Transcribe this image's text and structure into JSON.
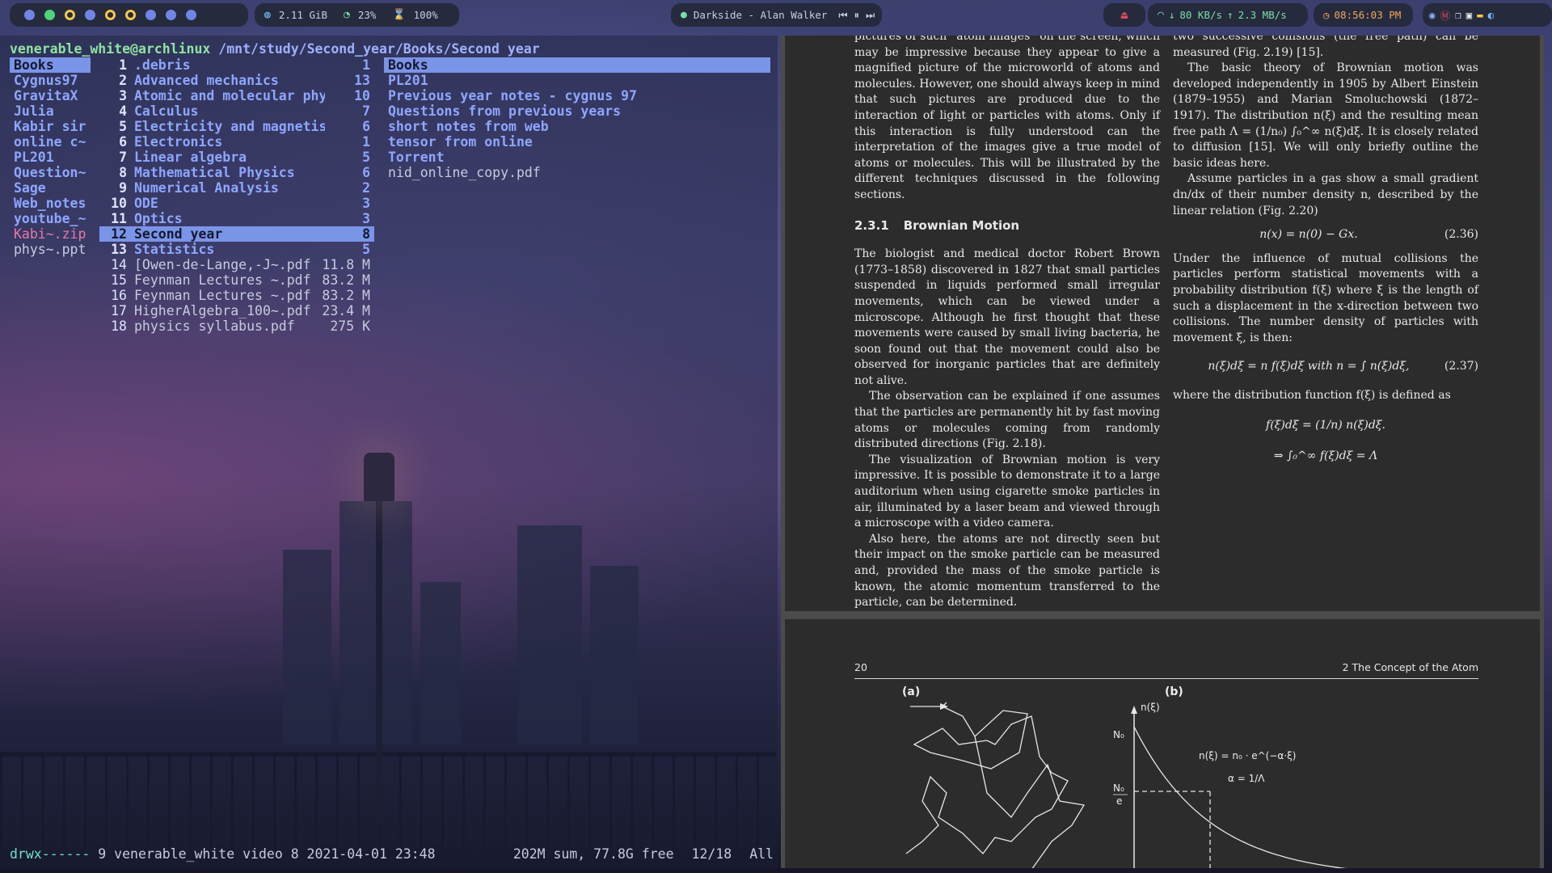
{
  "topbar": {
    "workspaces": [
      "filled",
      "active",
      "ring",
      "filled",
      "ring",
      "ring",
      "filled",
      "filled",
      "filled"
    ],
    "memory": "2.11 GiB",
    "cpu": "23%",
    "battery": "100%",
    "music": {
      "track": "Darkside - Alan Walker"
    },
    "network": {
      "down": "80 KB/s",
      "up": "2.3 MB/s"
    },
    "clock": "08:56:03 PM",
    "colors": {
      "pill_bg": "#262a3d",
      "accent": "#6f86e6",
      "active_ws": "#4fd37b",
      "ring_ws": "#f2c94c"
    }
  },
  "terminal": {
    "user_host": "venerable_white@archlinux",
    "path": " /mnt/study/Second_year/Books/Second year",
    "parent_column": [
      {
        "name": "Books",
        "type": "dir",
        "selected": true
      },
      {
        "name": "Cygnus97",
        "type": "dir"
      },
      {
        "name": "GravitaX",
        "type": "dir"
      },
      {
        "name": "Julia",
        "type": "dir"
      },
      {
        "name": "Kabir sir",
        "type": "dir"
      },
      {
        "name": "online c~",
        "type": "dir"
      },
      {
        "name": "PL201",
        "type": "dir"
      },
      {
        "name": "Question~",
        "type": "dir"
      },
      {
        "name": "Sage",
        "type": "dir"
      },
      {
        "name": "Web_notes",
        "type": "dir"
      },
      {
        "name": "youtube_~",
        "type": "dir"
      },
      {
        "name": "Kabi~.zip",
        "type": "arch"
      },
      {
        "name": "phys~.ppt",
        "type": "file"
      }
    ],
    "current_column": [
      {
        "num": "1",
        "name": ".debris",
        "size": "1",
        "type": "dir"
      },
      {
        "num": "2",
        "name": "Advanced mechanics",
        "size": "13",
        "type": "dir"
      },
      {
        "num": "3",
        "name": "Atomic and molecular phys~",
        "size": "10",
        "type": "dir"
      },
      {
        "num": "4",
        "name": "Calculus",
        "size": "7",
        "type": "dir"
      },
      {
        "num": "5",
        "name": "Electricity and magnetism",
        "size": "6",
        "type": "dir"
      },
      {
        "num": "6",
        "name": "Electronics",
        "size": "1",
        "type": "dir"
      },
      {
        "num": "7",
        "name": "Linear algebra",
        "size": "5",
        "type": "dir"
      },
      {
        "num": "8",
        "name": "Mathematical Physics",
        "size": "6",
        "type": "dir"
      },
      {
        "num": "9",
        "name": "Numerical Analysis",
        "size": "2",
        "type": "dir"
      },
      {
        "num": "10",
        "name": "ODE",
        "size": "3",
        "type": "dir"
      },
      {
        "num": "11",
        "name": "Optics",
        "size": "3",
        "type": "dir"
      },
      {
        "num": "12",
        "name": "Second year",
        "size": "8",
        "type": "dir",
        "selected": true
      },
      {
        "num": "13",
        "name": "Statistics",
        "size": "5",
        "type": "dir"
      },
      {
        "num": "14",
        "name": "[Owen-de-Lange,-J~.pdf",
        "size": "11.8 M",
        "type": "file"
      },
      {
        "num": "15",
        "name": "Feynman Lectures ~.pdf",
        "size": "83.2 M",
        "type": "file"
      },
      {
        "num": "16",
        "name": "Feynman Lectures ~.pdf",
        "size": "83.2 M",
        "type": "file"
      },
      {
        "num": "17",
        "name": "HigherAlgebra_100~.pdf",
        "size": "23.4 M",
        "type": "file"
      },
      {
        "num": "18",
        "name": "physics syllabus.pdf",
        "size": "275 K",
        "type": "file"
      }
    ],
    "preview_column": [
      {
        "name": "Books",
        "type": "dir",
        "selected": true
      },
      {
        "name": "PL201",
        "type": "dir"
      },
      {
        "name": "Previous year notes - cygnus 97",
        "type": "dir"
      },
      {
        "name": "Questions from previous years",
        "type": "dir"
      },
      {
        "name": "short notes from web",
        "type": "dir"
      },
      {
        "name": "tensor from online",
        "type": "dir"
      },
      {
        "name": "Torrent",
        "type": "dir"
      },
      {
        "name": "nid_online_copy.pdf",
        "type": "file"
      }
    ],
    "status": {
      "perms": "drwx------",
      "info": " 9 venerable_white video 8 2021-04-01 23:48",
      "summary": "202M sum, 77.8G free",
      "position": "12/18",
      "scroll": "All"
    }
  },
  "pdf": {
    "left_col": {
      "p1": "pictures of such “atom images” on the screen, which may be impressive because they appear to give a magnified picture of the microworld of atoms and molecules. However, one should always keep in mind that such pictures are produced due to the interaction of light or particles with atoms. Only if this interaction is fully understood can the interpretation of the images give a true model of atoms or molecules. This will be illustrated by the different techniques discussed in the following sections.",
      "section_num": "2.3.1",
      "section_title": "Brownian Motion",
      "p2": "The biologist and medical doctor Robert Brown (1773–1858) discovered in 1827 that small particles suspended in liquids performed small irregular movements, which can be viewed under a microscope. Although he first thought that these movements were caused by small living bacteria, he soon found out that the movement could also be observed for inorganic particles that are definitely not alive.",
      "p3": "The observation can be explained if one assumes that the particles are permanently hit by fast moving atoms or molecules coming from randomly distributed directions (Fig. 2.18).",
      "p4": "The visualization of Brownian motion is very impressive. It is possible to demonstrate it to a large auditorium when using cigarette smoke particles in air, illuminated by a laser beam and viewed through a microscope with a video camera.",
      "p5": "Also here, the atoms are not directly seen but their impact on the smoke particle can be measured and, provided the mass of the smoke particle is known, the atomic momentum transferred to the particle, can be determined."
    },
    "right_col": {
      "p0": "two successive collisions (the free path) can be measured (Fig. 2.19) [15].",
      "p1a": "The basic theory of Brownian motion was developed independently in 1905 by Albert Einstein (1879–1955) and Marian Smoluchowski (1872–1917). The distribution n(ξ) and the resulting mean free path Λ = (1/n₀) ∫₀^∞ n(ξ)dξ. It is closely related to diffusion [15]. We will only briefly outline the basic ideas here.",
      "p2": "Assume particles in a gas show a small gradient dn/dx of their number density n, described by the linear relation (Fig. 2.20)",
      "eq36": "n(x) = n(0) − Gx.",
      "eq36_num": "(2.36)",
      "p3": "Under the influence of mutual collisions the particles perform statistical movements with a probability distribution f(ξ) where ξ is the length of such a displacement in the x-direction between two collisions. The number density of particles with movement ξ, is then:",
      "eq37": "n(ξ)dξ = n f(ξ)dξ   with   n = ∫ n(ξ)dξ,",
      "eq37_num": "(2.37)",
      "p4": "where the distribution function f(ξ) is defined as",
      "eq38": "f(ξ)dξ = (1/n) n(ξ)dξ.",
      "eq39": "⇒ ∫₀^∞ f(ξ)dξ = Λ"
    },
    "page2": {
      "page_num": "20",
      "chapter": "2   The Concept of the Atom",
      "fig_a": "(a)",
      "fig_b": "(b)",
      "y_label": "n(ξ)",
      "n0": "N₀",
      "n0e_num": "N₀",
      "n0e_den": "e",
      "formula1": "n(ξ) = n₀ · e^(−α·ξ)",
      "formula2": "α = 1/Λ"
    }
  }
}
